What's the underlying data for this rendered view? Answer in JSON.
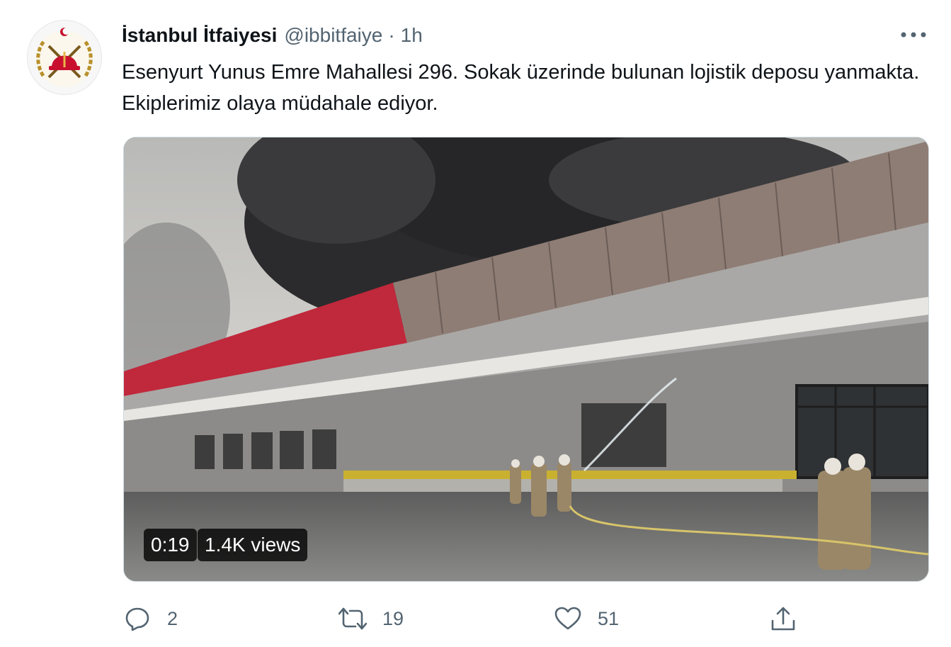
{
  "tweet": {
    "author_name": "İstanbul İtfaiyesi",
    "handle": "@ibbitfaiye",
    "separator": "·",
    "time": "1h",
    "text": "Esenyurt Yunus Emre Mahallesi 296. Sokak üzerinde bulunan lojistik deposu yanmakta. Ekiplerimiz olaya müdahale ediyor.",
    "avatar_icon": "fire-department-emblem-icon",
    "more_icon": "more-horizontal-icon"
  },
  "video": {
    "duration": "0:19",
    "views": "1.4K views"
  },
  "actions": {
    "reply": {
      "icon": "reply-icon",
      "count": "2"
    },
    "retweet": {
      "icon": "retweet-icon",
      "count": "19"
    },
    "like": {
      "icon": "heart-icon",
      "count": "51"
    },
    "share": {
      "icon": "share-icon"
    }
  },
  "colors": {
    "text_primary": "#0f1419",
    "text_secondary": "#536471",
    "emblem_red": "#c8102e",
    "emblem_gold": "#b8902a"
  }
}
